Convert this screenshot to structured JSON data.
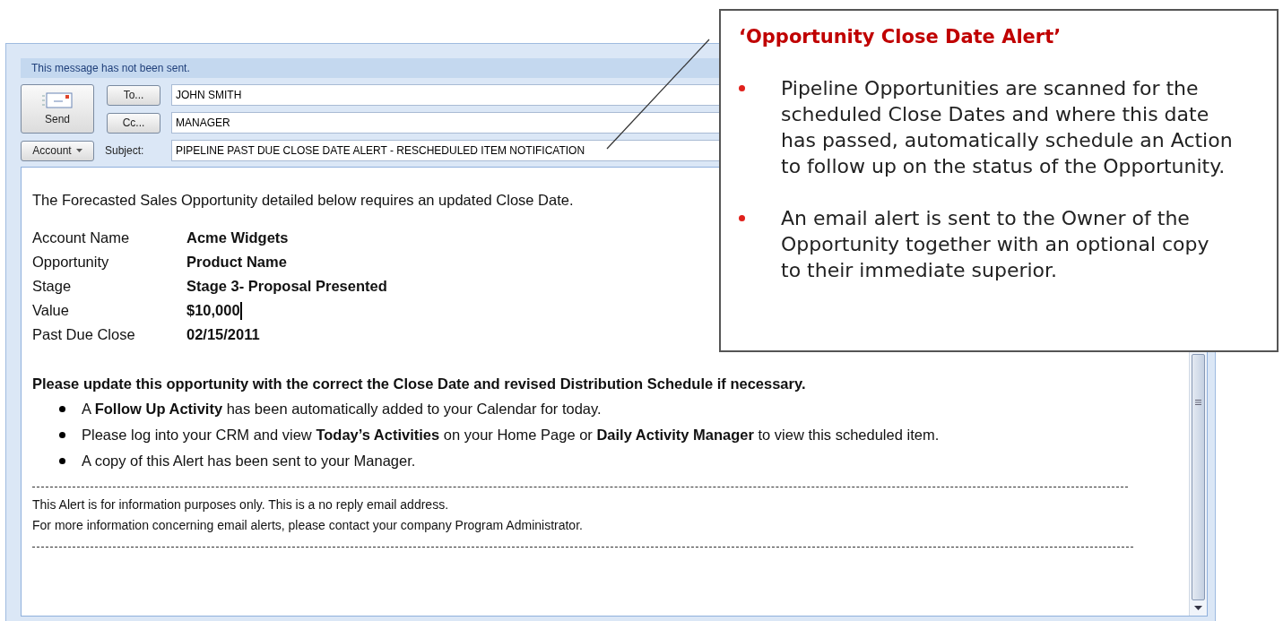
{
  "message_bar": "This message has not been sent.",
  "send_button": "Send",
  "to": {
    "button": "To...",
    "value": "JOHN SMITH"
  },
  "cc": {
    "button": "Cc...",
    "value": "MANAGER"
  },
  "account_button": "Account",
  "subject": {
    "label": "Subject:",
    "value": "PIPELINE PAST DUE CLOSE DATE ALERT - RESCHEDULED ITEM NOTIFICATION"
  },
  "body": {
    "intro": "The Forecasted Sales Opportunity detailed below requires an updated Close Date.",
    "fields": [
      {
        "label": "Account Name",
        "value": "Acme Widgets"
      },
      {
        "label": "Opportunity",
        "value": "Product Name"
      },
      {
        "label": "Stage",
        "value": "Stage 3- Proposal Presented"
      },
      {
        "label": "Value",
        "value": "$10,000",
        "cursor": true
      },
      {
        "label": "Past Due Close",
        "value": "02/15/2011"
      }
    ],
    "request": "Please update this opportunity with the correct the Close Date and revised Distribution Schedule if necessary.",
    "bullets": [
      "A **Follow Up Activity** has been automatically added to your Calendar for today.",
      "Please log into your CRM and view **Today’s Activities** on your Home Page or **Daily Activity Manager** to view this scheduled item.",
      "A copy of this Alert has been sent to your Manager."
    ],
    "footer": [
      "This Alert is for information purposes only. This is a no reply email address.",
      "For more information concerning email alerts, please contact your company Program Administrator."
    ]
  },
  "callout": {
    "title": "‘Opportunity Close Date Alert’",
    "bullets": [
      "Pipeline Opportunities are scanned for the scheduled Close Dates and where this date has passed, automatically schedule an Action to follow up on the status of the Opportunity.",
      "An email alert is sent to the Owner of the Opportunity together with an optional copy to their immediate superior."
    ]
  }
}
